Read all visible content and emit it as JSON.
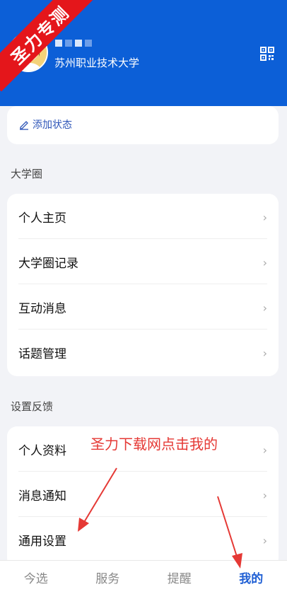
{
  "watermark": {
    "ribbon_text": "圣力专测"
  },
  "user": {
    "name_masked": "■ ■ ■",
    "school": "苏州职业技术大学"
  },
  "status": {
    "add_status_label": "添加状态"
  },
  "sections": [
    {
      "title": "大学圈",
      "items": [
        "个人主页",
        "大学圈记录",
        "互动消息",
        "话题管理"
      ]
    },
    {
      "title": "设置反馈",
      "items": [
        "个人资料",
        "消息通知",
        "通用设置"
      ]
    }
  ],
  "annotation": {
    "text": "圣力下载网点击我的"
  },
  "tabs": [
    {
      "label": "今选",
      "active": false
    },
    {
      "label": "服务",
      "active": false
    },
    {
      "label": "提醒",
      "active": false
    },
    {
      "label": "我的",
      "active": true
    }
  ],
  "colors": {
    "header_bg": "#0c5fd7",
    "ribbon": "#e4161b",
    "accent": "#1f5fd4",
    "annotation": "#e53935"
  },
  "icons": {
    "qr": "qr-code-icon",
    "edit": "pencil-icon",
    "chevron": "chevron-right-icon"
  }
}
